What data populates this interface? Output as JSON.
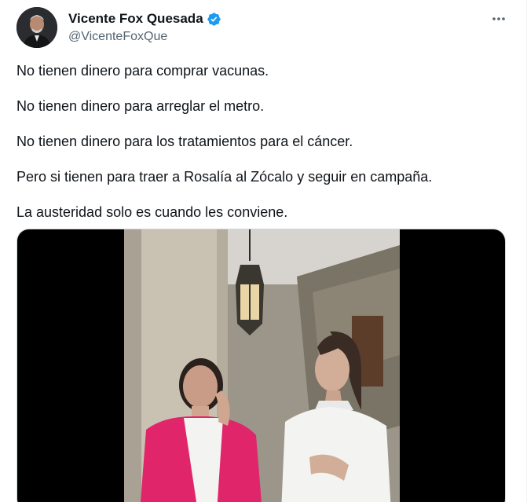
{
  "author": {
    "display_name": "Vicente Fox Quesada",
    "handle": "@VicenteFoxQue",
    "verified_icon": "verified-badge-icon",
    "avatar": "profile-photo"
  },
  "menu": {
    "more_icon": "more-options-icon"
  },
  "tweet": {
    "lines": [
      "No tienen dinero para comprar vacunas.",
      "No tienen dinero para arreglar el metro.",
      "No tienen dinero para los tratamientos para el cáncer.",
      "Pero si tienen para traer a Rosalía al Zócalo y seguir en campaña.",
      "La austeridad solo es cuando les conviene."
    ]
  },
  "media": {
    "type": "video",
    "description_icon": "video-thumbnail",
    "colors": {
      "letterbox": "#000000",
      "pink_blazer": "#e0256a",
      "white_top": "#f3f3f1"
    }
  },
  "colors": {
    "text": "#0f1419",
    "secondary": "#536471",
    "verified": "#1d9bf0"
  }
}
